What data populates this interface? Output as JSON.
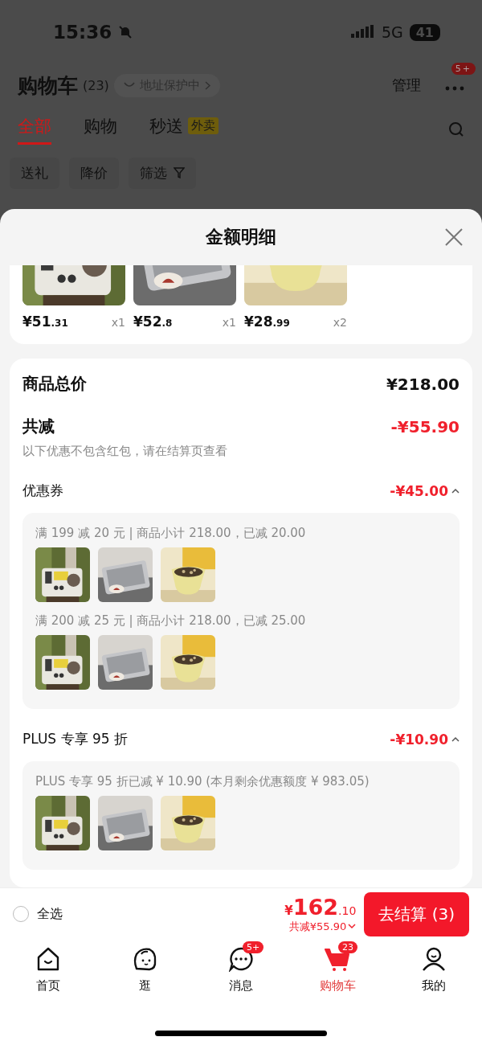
{
  "status_bar": {
    "time": "15:36",
    "network": "5G",
    "battery": "41"
  },
  "header": {
    "title": "购物车",
    "count": "(23)",
    "address": "地址保护中",
    "manage": "管理",
    "more_badge": "5+"
  },
  "tabs": [
    {
      "label": "全部",
      "selected": true
    },
    {
      "label": "购物",
      "selected": false
    },
    {
      "label": "秒送",
      "selected": false,
      "tag": "外卖"
    }
  ],
  "chips": [
    {
      "label": "送礼",
      "kind": "plain"
    },
    {
      "label": "降价",
      "kind": "plain"
    },
    {
      "label": "筛选",
      "kind": "filter"
    }
  ],
  "sheet": {
    "title": "金额明细",
    "items": [
      {
        "price": "¥51",
        "decimals": ".31",
        "qty": "x1"
      },
      {
        "price": "¥52",
        "decimals": ".8",
        "qty": "x1"
      },
      {
        "price": "¥28",
        "decimals": ".99",
        "qty": "x2"
      }
    ],
    "total": {
      "label": "商品总价",
      "value": "¥218.00"
    },
    "discount": {
      "label": "共减",
      "value": "-¥55.90",
      "note": "以下优惠不包含红包，请在结算页查看"
    },
    "sections": [
      {
        "label": "优惠券",
        "value": "-¥45.00",
        "expanded": true,
        "groups": [
          {
            "text": "满 199 减 20 元 | 商品小计 218.00，已减 20.00"
          },
          {
            "text": "满 200 减 25 元 | 商品小计 218.00，已减 25.00"
          }
        ]
      },
      {
        "label": "PLUS 专享 95 折",
        "value": "-¥10.90",
        "expanded": true,
        "groups": [
          {
            "text": "PLUS 专享 95 折已减 ¥ 10.90 (本月剩余优惠额度 ¥ 983.05)"
          }
        ]
      }
    ]
  },
  "checkout_bar": {
    "select_all": {
      "label": "全选",
      "checked": false
    },
    "currency": "¥",
    "amount": "162",
    "decimals": ".10",
    "saved": "共减¥55.90",
    "button": "去结算 (3)"
  },
  "nav": [
    {
      "label": "首页",
      "kind": "home",
      "selected": false
    },
    {
      "label": "逛",
      "kind": "stroll",
      "selected": false
    },
    {
      "label": "消息",
      "kind": "message",
      "selected": false,
      "badge": "5+"
    },
    {
      "label": "购物车",
      "kind": "cart",
      "selected": true,
      "badge": "23"
    },
    {
      "label": "我的",
      "kind": "profile",
      "selected": false
    }
  ]
}
